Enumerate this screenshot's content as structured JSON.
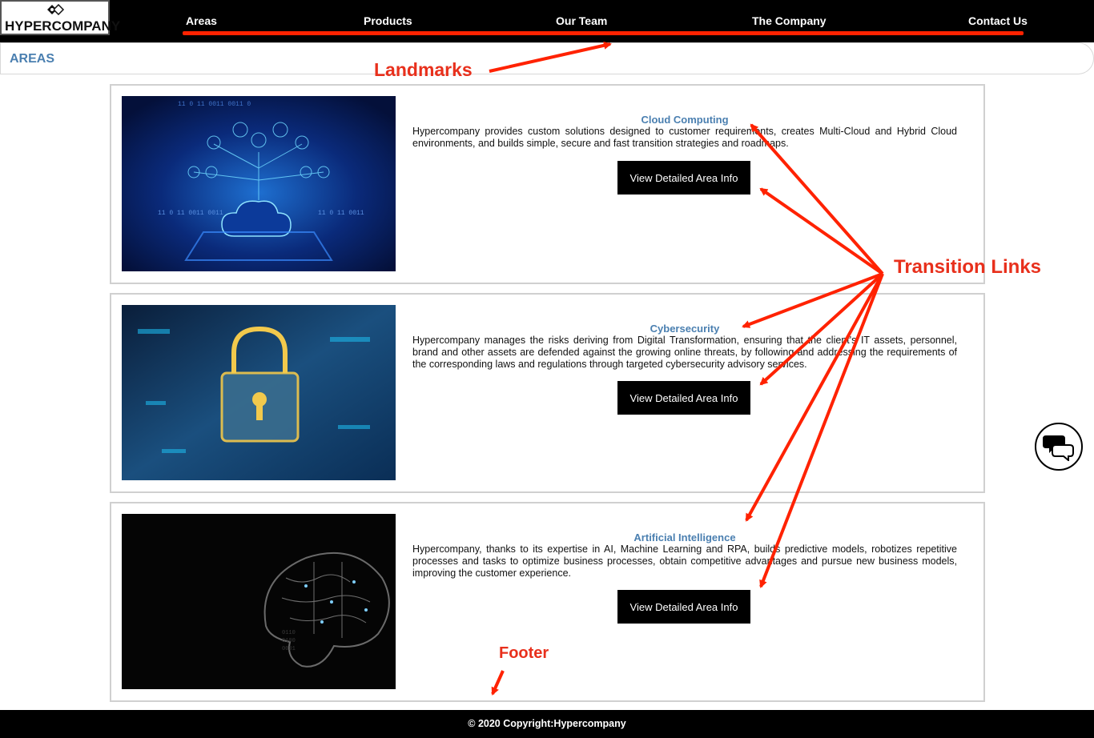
{
  "brand": {
    "logo_text": "HYPERCOMPANY"
  },
  "nav": {
    "items": [
      {
        "label": "Areas"
      },
      {
        "label": "Products"
      },
      {
        "label": "Our Team"
      },
      {
        "label": "The Company"
      },
      {
        "label": "Contact Us"
      }
    ]
  },
  "section": {
    "title": "AREAS"
  },
  "cards": [
    {
      "title": "Cloud Computing",
      "description": "Hypercompany provides custom solutions designed to customer requirements, creates Multi-Cloud and Hybrid Cloud environments, and builds simple, secure and fast transition strategies and roadmaps.",
      "button_label": "View Detailed Area Info",
      "image_icon": "cloud-computing-image"
    },
    {
      "title": "Cybersecurity",
      "description": "Hypercompany manages the risks deriving from Digital Transformation, ensuring that the client's IT assets, personnel, brand and other assets are defended against the growing online threats, by following and addressing the requirements of the corresponding laws and regulations through targeted cybersecurity advisory services.",
      "button_label": "View Detailed Area Info",
      "image_icon": "cybersecurity-lock-image"
    },
    {
      "title": "Artificial Intelligence",
      "description": "Hypercompany, thanks to its expertise in AI, Machine Learning and RPA, builds predictive models, robotizes repetitive processes and tasks to optimize business processes, obtain competitive advantages and pursue new business models, improving the customer experience.",
      "button_label": "View Detailed Area Info",
      "image_icon": "ai-brain-image"
    }
  ],
  "annotations": {
    "landmarks": "Landmarks",
    "transition_links": "Transition Links",
    "footer": "Footer",
    "color": "#e8301c"
  },
  "chat": {
    "icon": "chat-bubbles-icon"
  },
  "footer": {
    "text": "© 2020  Copyright:Hypercompany"
  },
  "colors": {
    "accent": "#4a7fb0",
    "header_bg": "#000000",
    "annotation_red": "#ff2200"
  }
}
